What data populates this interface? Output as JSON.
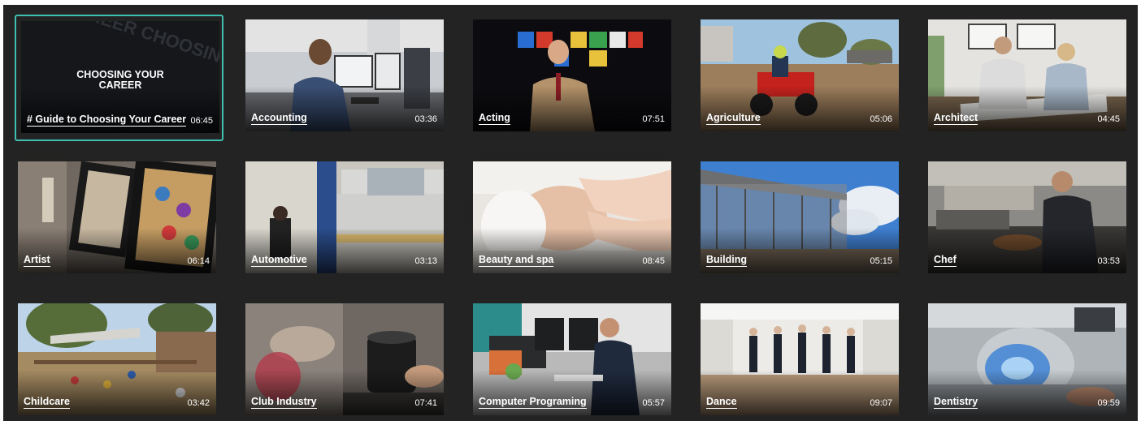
{
  "videos": [
    {
      "title": "# Guide to Choosing Your Career",
      "duration": "06:45",
      "overlay_line1": "CHOOSING YOUR",
      "overlay_line2": "CAREER",
      "bg_words": "YOUR CAREER CHOOSING YOUR CAREER CHOOSING",
      "accent": "#3fbfb0"
    },
    {
      "title": "Accounting",
      "duration": "03:36"
    },
    {
      "title": "Acting",
      "duration": "07:51"
    },
    {
      "title": "Agriculture",
      "duration": "05:06"
    },
    {
      "title": "Architect",
      "duration": "04:45"
    },
    {
      "title": "Artist",
      "duration": "06:14"
    },
    {
      "title": "Automotive",
      "duration": "03:13"
    },
    {
      "title": "Beauty and spa",
      "duration": "08:45"
    },
    {
      "title": "Building",
      "duration": "05:15"
    },
    {
      "title": "Chef",
      "duration": "03:53"
    },
    {
      "title": "Childcare",
      "duration": "03:42"
    },
    {
      "title": "Club Industry",
      "duration": "07:41"
    },
    {
      "title": "Computer Programing",
      "duration": "05:57"
    },
    {
      "title": "Dance",
      "duration": "09:07"
    },
    {
      "title": "Dentistry",
      "duration": "09:59"
    }
  ]
}
